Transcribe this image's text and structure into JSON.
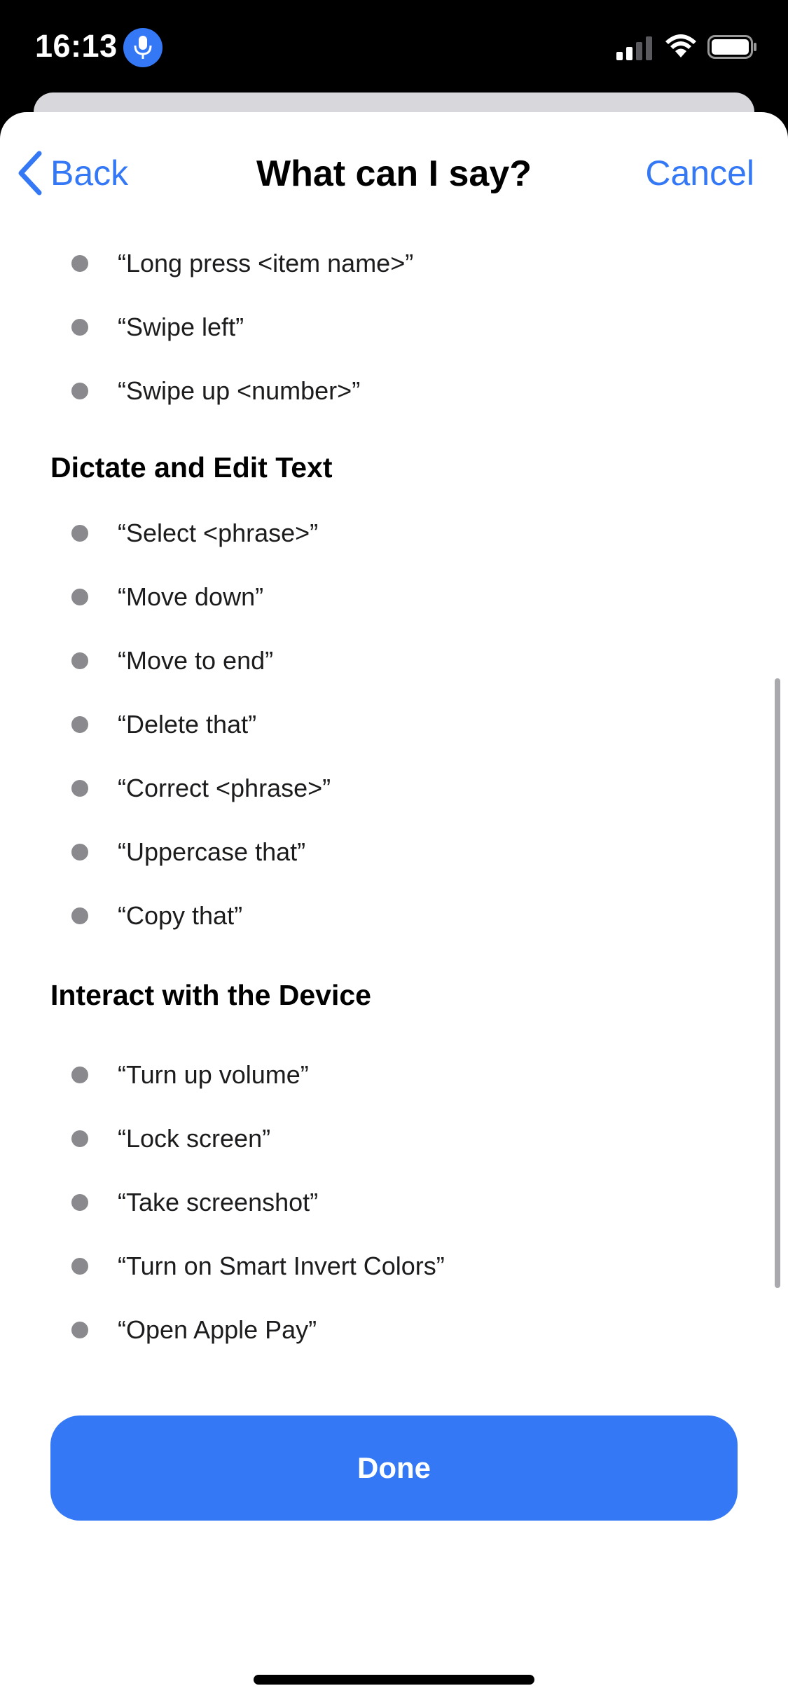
{
  "status_bar": {
    "time": "16:13",
    "mic_icon": "microphone-icon",
    "signal_icon": "cellular-signal-icon",
    "wifi_icon": "wifi-icon",
    "battery_icon": "battery-icon"
  },
  "nav": {
    "back_label": "Back",
    "title": "What can I say?",
    "cancel_label": "Cancel",
    "back_icon": "chevron-left-icon"
  },
  "sections": {
    "top_items": [
      "“Long press <item name>”",
      "“Swipe left”",
      "“Swipe up <number>”"
    ],
    "dictate": {
      "heading": "Dictate and Edit Text",
      "items": [
        "“Select <phrase>”",
        "“Move down”",
        "“Move to end”",
        "“Delete that”",
        "“Correct <phrase>”",
        "“Uppercase that”",
        "“Copy that”"
      ]
    },
    "device": {
      "heading": "Interact with the Device",
      "items": [
        "“Turn up volume”",
        "“Lock screen”",
        "“Take screenshot”",
        "“Turn on Smart Invert Colors”",
        "“Open Apple Pay”"
      ]
    }
  },
  "done_label": "Done",
  "colors": {
    "accent": "#3478f6",
    "bullet": "#8a8a8e",
    "background": "#ffffff"
  }
}
